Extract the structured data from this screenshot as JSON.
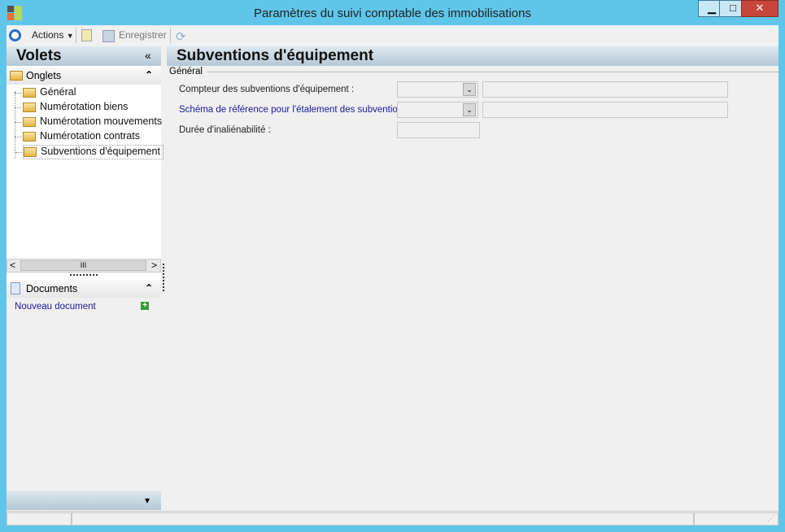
{
  "window": {
    "title": "Paramètres du suivi comptable des immobilisations",
    "minimize": "▁",
    "maximize": "□",
    "close": "✕"
  },
  "toolbar": {
    "actions_label": "Actions",
    "save_label": "Enregistrer"
  },
  "left_panel": {
    "title": "Volets",
    "collapse": "«",
    "onglets": {
      "label": "Onglets",
      "toggle": "⌃",
      "items": [
        {
          "label": "Général"
        },
        {
          "label": "Numérotation biens"
        },
        {
          "label": "Numérotation mouvements"
        },
        {
          "label": "Numérotation contrats"
        },
        {
          "label": "Subventions d'équipement"
        }
      ]
    },
    "scrollbar": {
      "left": "<",
      "thumb": "III",
      "right": ">"
    },
    "documents": {
      "label": "Documents",
      "toggle": "⌃",
      "new_document": "Nouveau document",
      "add": "+"
    },
    "bottom_arrow": "▾"
  },
  "main": {
    "title": "Subventions d'équipement",
    "group": "Général",
    "fields": [
      {
        "label": "Compteur des subventions d'équipement :",
        "value": "",
        "desc": ""
      },
      {
        "label": "Schéma de référence pour l'étalement des subventions :",
        "value": "",
        "desc": ""
      },
      {
        "label": "Durée d'inaliénabilité :",
        "value": ""
      }
    ],
    "dropdown_icon": "⌄"
  },
  "colors": {
    "frame": "#5fc6ea",
    "link": "#1a1aa0"
  }
}
